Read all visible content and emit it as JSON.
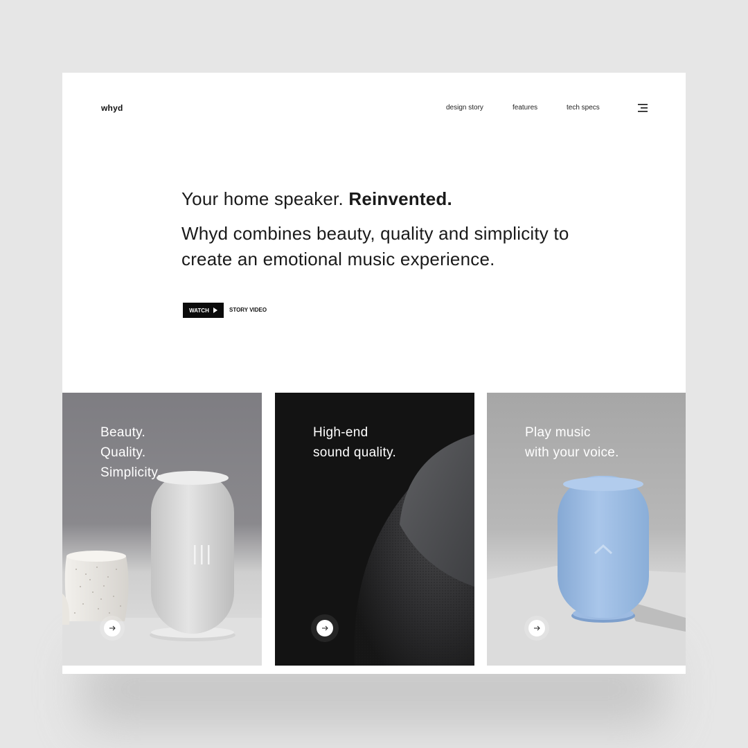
{
  "brand": {
    "name": "whyd"
  },
  "nav": {
    "items": [
      "design story",
      "features",
      "tech specs"
    ],
    "menu_icon": "hamburger-menu-icon"
  },
  "hero": {
    "headline_regular": "Your home speaker. ",
    "headline_bold": "Reinvented.",
    "subheadline": "Whyd combines beauty, quality and simplicity to create an emotional music experience.",
    "watch_label": "WATCH",
    "story_label": "STORY VIDEO"
  },
  "cards": [
    {
      "lines": [
        "Beauty.",
        "Quality.",
        "Simplicity."
      ],
      "image": "white-speaker-with-vase",
      "icon": "arrow-right-icon"
    },
    {
      "lines": [
        "High-end",
        "sound quality."
      ],
      "image": "dark-speaker-closeup",
      "icon": "arrow-right-icon"
    },
    {
      "lines": [
        "Play music",
        "with your voice."
      ],
      "image": "blue-speaker",
      "icon": "arrow-right-icon"
    }
  ],
  "colors": {
    "background": "#e6e6e6",
    "page": "#ffffff",
    "text": "#1a1a1a",
    "button": "#0b0b0b",
    "accent_blue": "#9fbfe3"
  }
}
